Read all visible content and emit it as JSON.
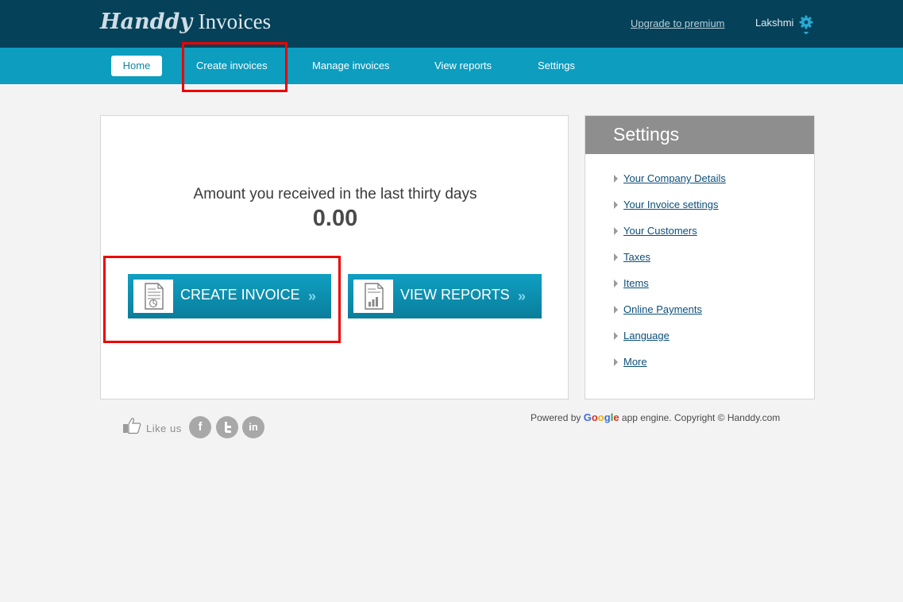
{
  "header": {
    "logo_script": "Handdy",
    "logo_plain": "Invoices",
    "upgrade_link": "Upgrade to premium",
    "user_name": "Lakshmi"
  },
  "nav": {
    "home": "Home",
    "create": "Create invoices",
    "manage": "Manage invoices",
    "reports": "View reports",
    "settings": "Settings"
  },
  "main": {
    "amount_label": "Amount you received in the last thirty days",
    "amount_value": "0.00",
    "create_button": "CREATE INVOICE",
    "reports_button": "VIEW REPORTS",
    "chevron": "»"
  },
  "sidebar": {
    "title": "Settings",
    "items": [
      {
        "label": "Your Company Details"
      },
      {
        "label": "Your Invoice settings"
      },
      {
        "label": "Your Customers"
      },
      {
        "label": "Taxes"
      },
      {
        "label": "Items"
      },
      {
        "label": "Online Payments"
      },
      {
        "label": "Language"
      },
      {
        "label": "More"
      }
    ]
  },
  "footer": {
    "like_us": "Like us",
    "facebook": "f",
    "linkedin": "in",
    "powered_prefix": "Powered by",
    "google_letters": [
      "G",
      "o",
      "o",
      "g",
      "l",
      "e"
    ],
    "powered_suffix": "app engine. Copyright © Handdy.com"
  },
  "colors": {
    "header_bg": "#054159",
    "nav_bg": "#0c9dbf",
    "button_top": "#109fc2",
    "button_bottom": "#0a7e9b",
    "highlight": "#ee0000",
    "sidebar_head": "#8e8e8e",
    "link": "#0b4f7a"
  }
}
